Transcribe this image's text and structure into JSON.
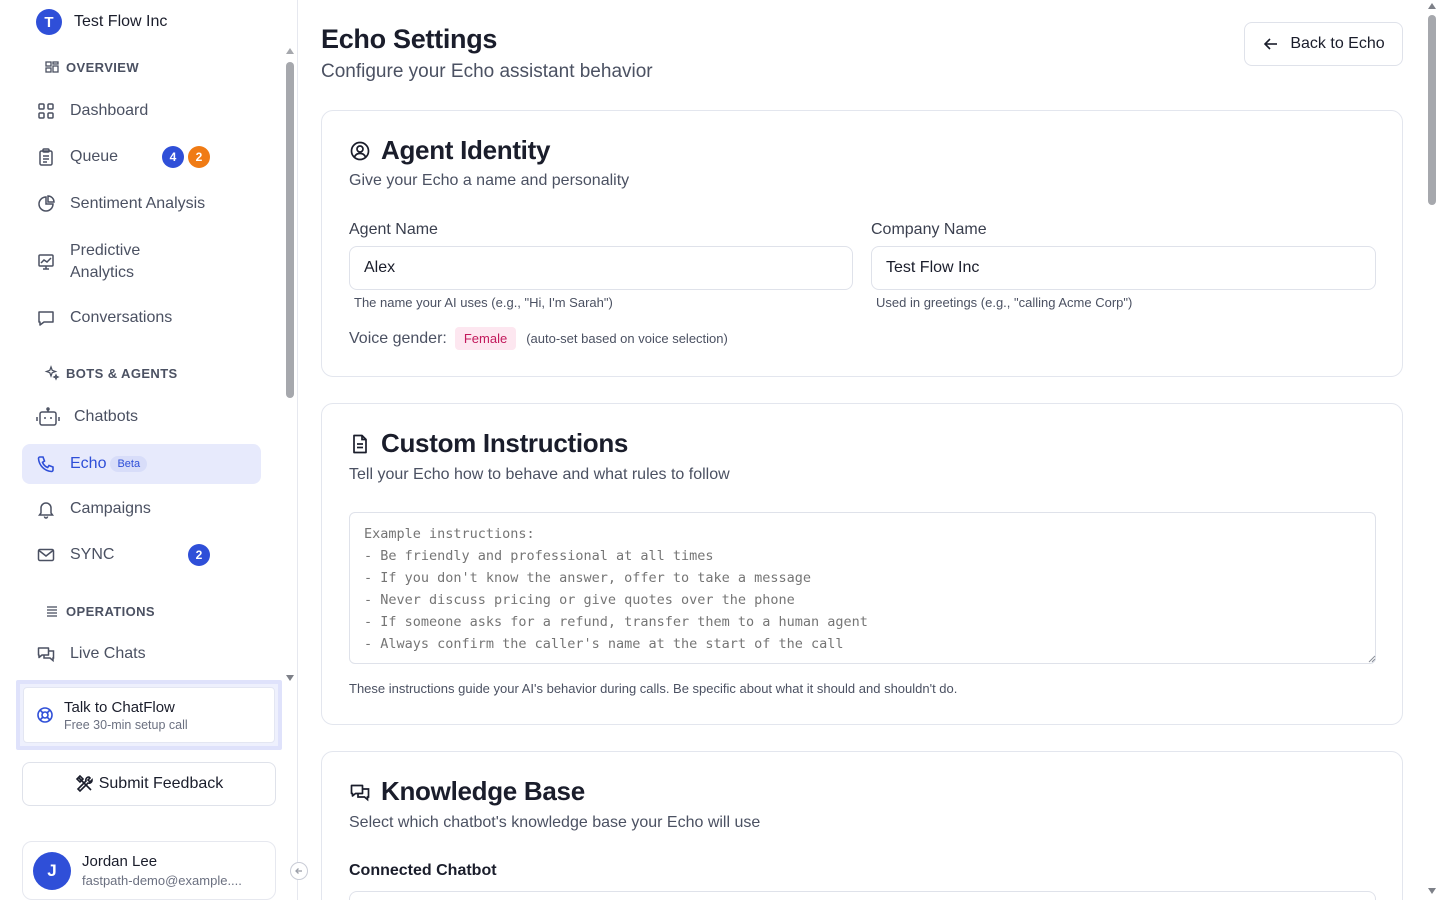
{
  "org": {
    "avatar_letter": "T",
    "name": "Test Flow Inc"
  },
  "sidebar": {
    "sections": {
      "overview": "OVERVIEW",
      "bots_agents": "BOTS & AGENTS",
      "operations": "OPERATIONS"
    },
    "items": [
      {
        "label": "Dashboard",
        "icon": "dashboard-icon"
      },
      {
        "label": "Queue",
        "icon": "clipboard-icon",
        "badges": [
          "4",
          "2"
        ]
      },
      {
        "label": "Sentiment Analysis",
        "icon": "pie-chart-icon"
      },
      {
        "label": "Predictive Analytics",
        "icon": "presentation-chart-icon"
      },
      {
        "label": "Conversations",
        "icon": "message-icon"
      },
      {
        "label": "Chatbots",
        "icon": "bot-icon"
      },
      {
        "label": "Echo",
        "icon": "phone-icon",
        "tag": "Beta",
        "active": true
      },
      {
        "label": "Campaigns",
        "icon": "bell-icon"
      },
      {
        "label": "SYNC",
        "icon": "mail-icon",
        "badges": [
          "2"
        ]
      },
      {
        "label": "Live Chats",
        "icon": "chats-icon"
      }
    ],
    "talk": {
      "title": "Talk to ChatFlow",
      "subtitle": "Free 30-min setup call"
    },
    "feedback_label": "Submit Feedback",
    "user": {
      "avatar_letter": "J",
      "name": "Jordan Lee",
      "email": "fastpath-demo@example...."
    }
  },
  "header": {
    "title": "Echo Settings",
    "subtitle": "Configure your Echo assistant behavior",
    "back_label": "Back to Echo"
  },
  "identity": {
    "title": "Agent Identity",
    "subtitle": "Give your Echo a name and personality",
    "agent_name_label": "Agent Name",
    "agent_name_value": "Alex",
    "agent_name_hint": "The name your AI uses (e.g., \"Hi, I'm Sarah\")",
    "company_name_label": "Company Name",
    "company_name_value": "Test Flow Inc",
    "company_name_hint": "Used in greetings (e.g., \"calling Acme Corp\")",
    "voice_label": "Voice gender:",
    "voice_value": "Female",
    "voice_note": "(auto-set based on voice selection)"
  },
  "instructions": {
    "title": "Custom Instructions",
    "subtitle": "Tell your Echo how to behave and what rules to follow",
    "placeholder": "Example instructions:\n- Be friendly and professional at all times\n- If you don't know the answer, offer to take a message\n- Never discuss pricing or give quotes over the phone\n- If someone asks for a refund, transfer them to a human agent\n- Always confirm the caller's name at the start of the call",
    "help": "These instructions guide your AI's behavior during calls. Be specific about what it should and shouldn't do."
  },
  "knowledge": {
    "title": "Knowledge Base",
    "subtitle": "Select which chatbot's knowledge base your Echo will use",
    "connected_label": "Connected Chatbot"
  },
  "colors": {
    "accent": "#2f4fd8",
    "badge_orange": "#f07b14",
    "active_bg": "#e7eafc",
    "female_pill": "#c2185b"
  }
}
